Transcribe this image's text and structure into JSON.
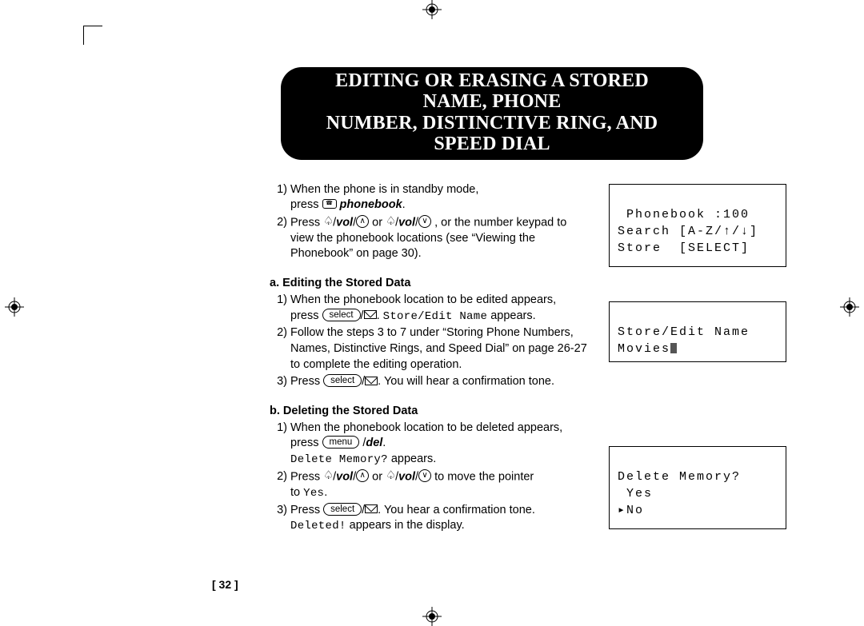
{
  "title_line1": "EDITING OR ERASING A STORED NAME, PHONE",
  "title_line2": "NUMBER, DISTINCTIVE RING, AND SPEED DIAL",
  "intro": {
    "step1_a": "When the phone is in standby mode,",
    "step1_b": "press ",
    "step1_c": "phonebook",
    "step1_d": ".",
    "step2_a": "Press ",
    "step2_b": "/",
    "vol": "vol",
    "step2_c": "  or  ",
    "step2_d": ", or the number keypad",
    "step2_e": "to view the phonebook locations (see “Viewing the Phonebook” on page 30)."
  },
  "section_a": {
    "head": "a. Editing the Stored Data",
    "s1_a": "When the phonebook location to be edited appears,",
    "s1_b": "press  ",
    "select_label": "select",
    "s1_c": ". ",
    "s1_lcd": "Store/Edit Name",
    "s1_d": " appears.",
    "s2": "Follow the steps 3 to 7 under “Storing Phone Numbers, Names, Distinctive Rings, and Speed Dial” on page 26-27 to complete the editing operation.",
    "s3_a": "Press  ",
    "s3_b": ". You will hear a confirmation tone."
  },
  "section_b": {
    "head": "b. Deleting the Stored Data",
    "s1_a": "When the phonebook location to be deleted appears,",
    "s1_b": "press ",
    "menu_label": "menu",
    "s1_c": " /",
    "del": "del",
    "s1_d": ".",
    "s1_lcd": "Delete Memory?",
    "s1_e": " appears.",
    "s2_a": "Press ",
    "s2_b": "  or  ",
    "s2_c": "  to move the pointer ",
    "s2_d": "to ",
    "yes": "Yes",
    "s2_e": ".",
    "s3_a": "Press  ",
    "s3_b": ". You hear a confirmation tone.",
    "s3_lcd": "Deleted!",
    "s3_c": " appears in the display."
  },
  "lcd1": {
    "l1": " Phonebook :100",
    "l2": "Search [A-Z/↑/↓]",
    "l3": "Store  [SELECT]"
  },
  "lcd2": {
    "l1": "Store/Edit Name",
    "l2": "Movies"
  },
  "lcd3": {
    "l1": "Delete Memory?",
    "l2": " Yes",
    "l3": "▸No"
  },
  "page_number": "[ 32 ]"
}
